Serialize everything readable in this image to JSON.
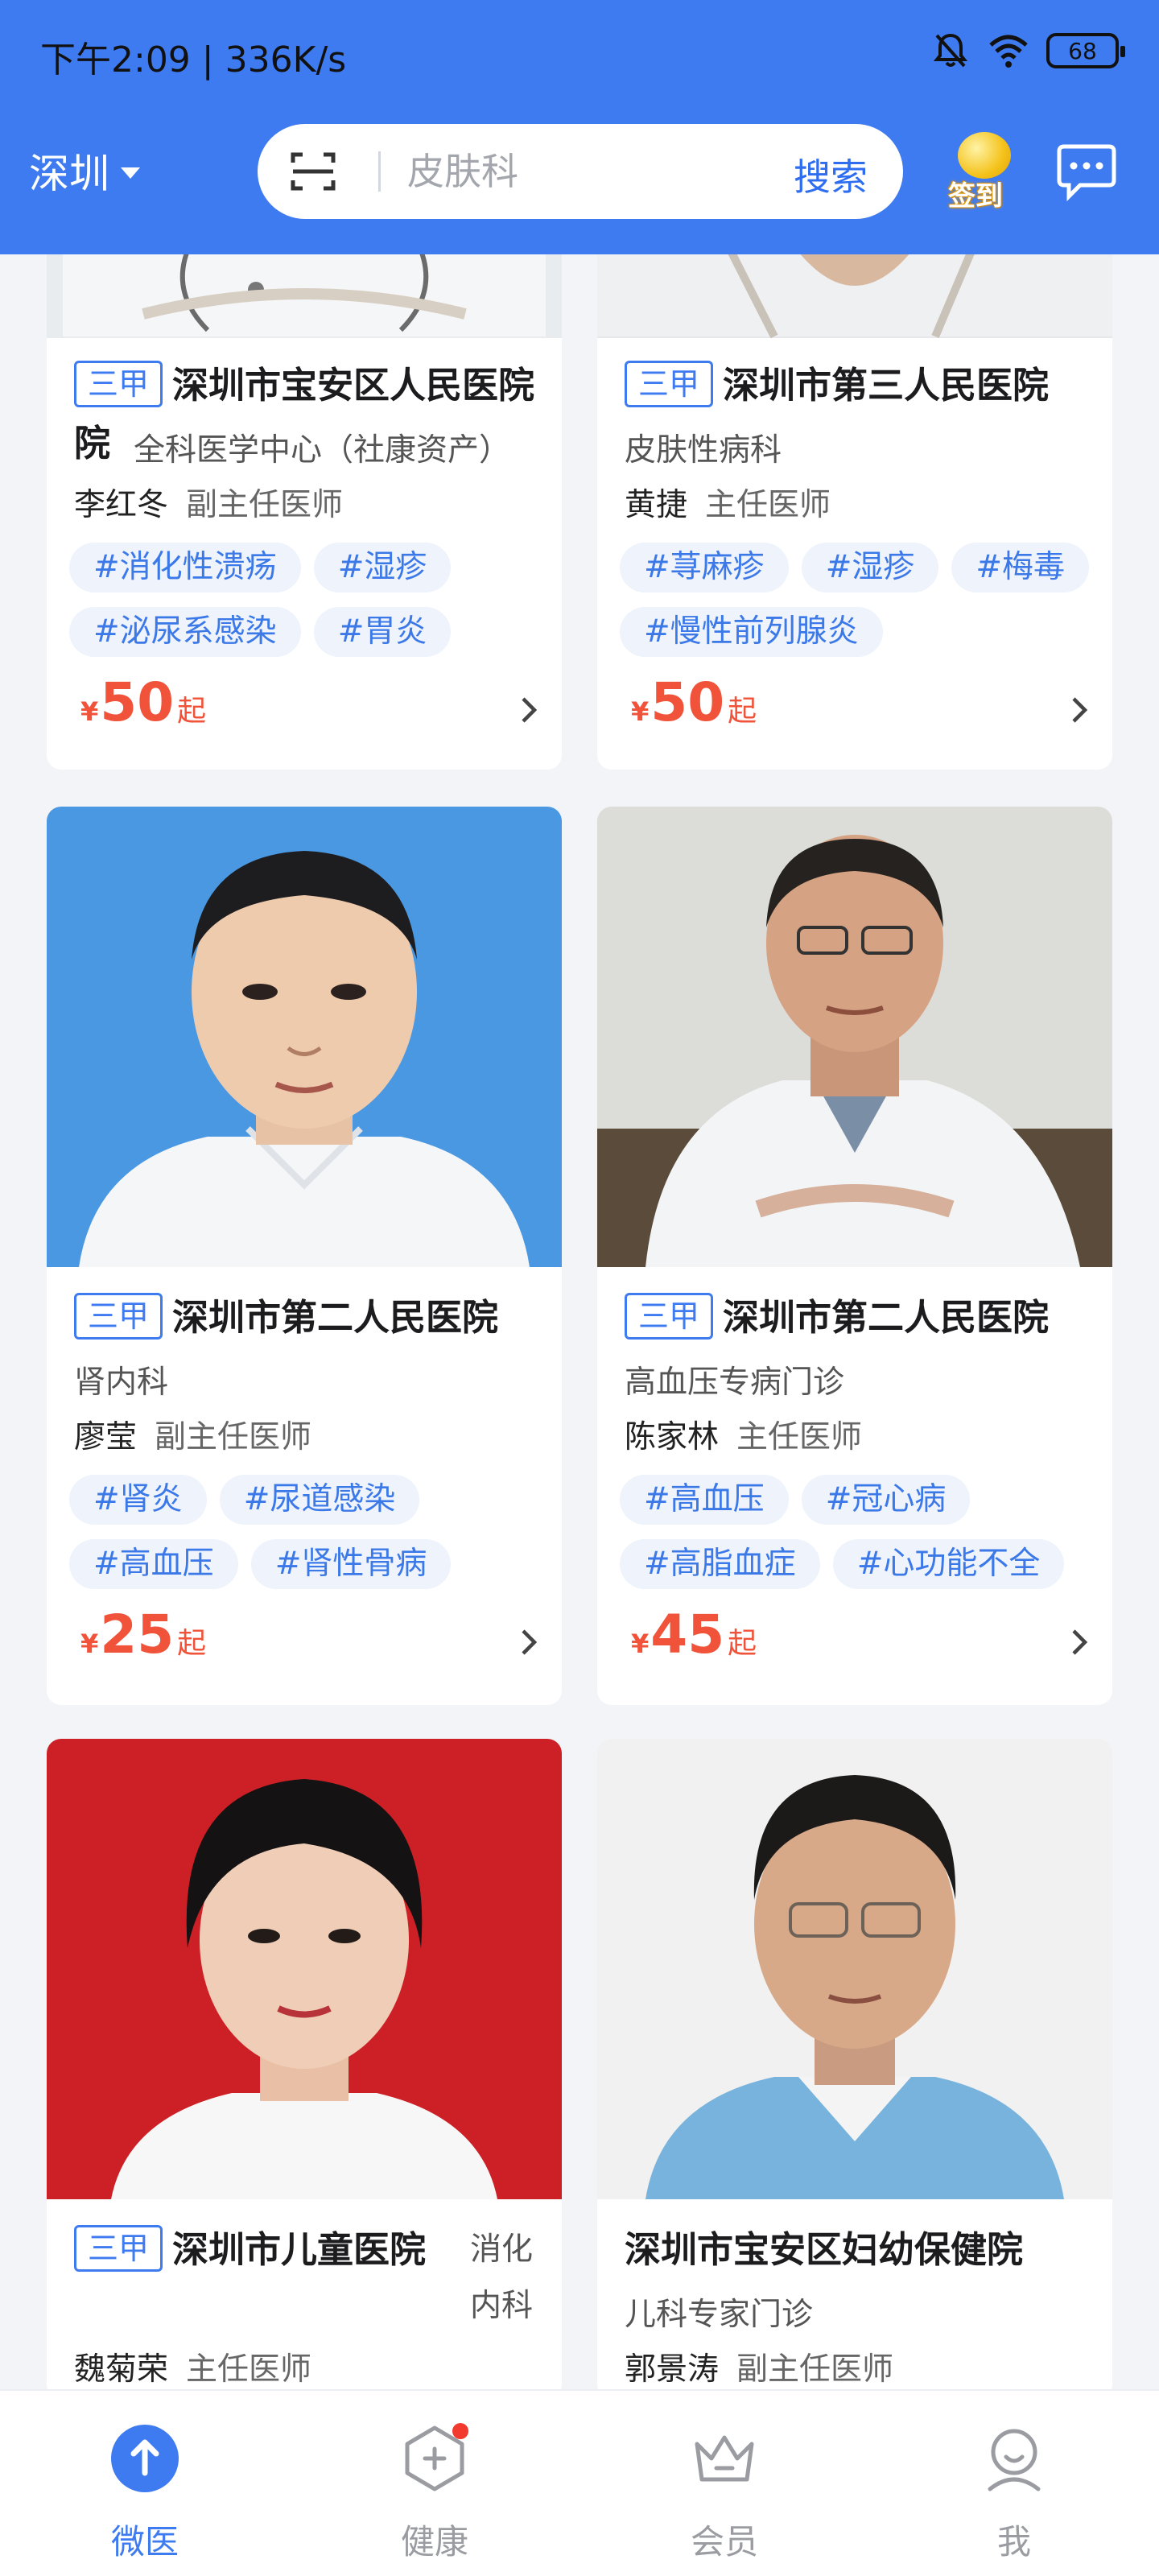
{
  "status_bar": {
    "time": "下午2:09 | 336K/s",
    "battery": "68"
  },
  "header": {
    "city": "深圳",
    "search_placeholder": "皮肤科",
    "search_button": "搜索",
    "signin_label": "签到",
    "accent_color": "#3f7bf0"
  },
  "cards": [
    {
      "badge": "三甲",
      "hospital": "深圳市宝安区人民医院",
      "department": "全科医学中心（社康资产）",
      "doctor": "李红冬",
      "title": "副主任医师",
      "tags": [
        "#消化性溃疡",
        "#湿疹",
        "#泌尿系感染",
        "#胃炎"
      ],
      "price_symbol": "¥",
      "price": "50",
      "price_suffix": "起"
    },
    {
      "badge": "三甲",
      "hospital": "深圳市第三人民医院",
      "department": "皮肤性病科",
      "doctor": "黄捷",
      "title": "主任医师",
      "tags": [
        "#荨麻疹",
        "#湿疹",
        "#梅毒",
        "#慢性前列腺炎"
      ],
      "price_symbol": "¥",
      "price": "50",
      "price_suffix": "起"
    },
    {
      "badge": "三甲",
      "hospital": "深圳市第二人民医院",
      "department": "肾内科",
      "doctor": "廖莹",
      "title": "副主任医师",
      "tags": [
        "#肾炎",
        "#尿道感染",
        "#高血压",
        "#肾性骨病"
      ],
      "price_symbol": "¥",
      "price": "25",
      "price_suffix": "起"
    },
    {
      "badge": "三甲",
      "hospital": "深圳市第二人民医院",
      "department": "高血压专病门诊",
      "doctor": "陈家林",
      "title": "主任医师",
      "tags": [
        "#高血压",
        "#冠心病",
        "#高脂血症",
        "#心功能不全"
      ],
      "price_symbol": "¥",
      "price": "45",
      "price_suffix": "起"
    },
    {
      "badge": "三甲",
      "hospital": "深圳市儿童医院",
      "department": "消化内科",
      "doctor": "魏菊荣",
      "title": "主任医师"
    },
    {
      "hospital": "深圳市宝安区妇幼保健院",
      "department": "儿科专家门诊",
      "doctor": "郭景涛",
      "title": "副主任医师"
    }
  ],
  "bottom_nav": [
    {
      "label": "微医",
      "icon": "home-up-icon",
      "active": true
    },
    {
      "label": "健康",
      "icon": "health-icon",
      "active": false
    },
    {
      "label": "会员",
      "icon": "crown-icon",
      "active": false
    },
    {
      "label": "我",
      "icon": "profile-icon",
      "active": false
    }
  ]
}
